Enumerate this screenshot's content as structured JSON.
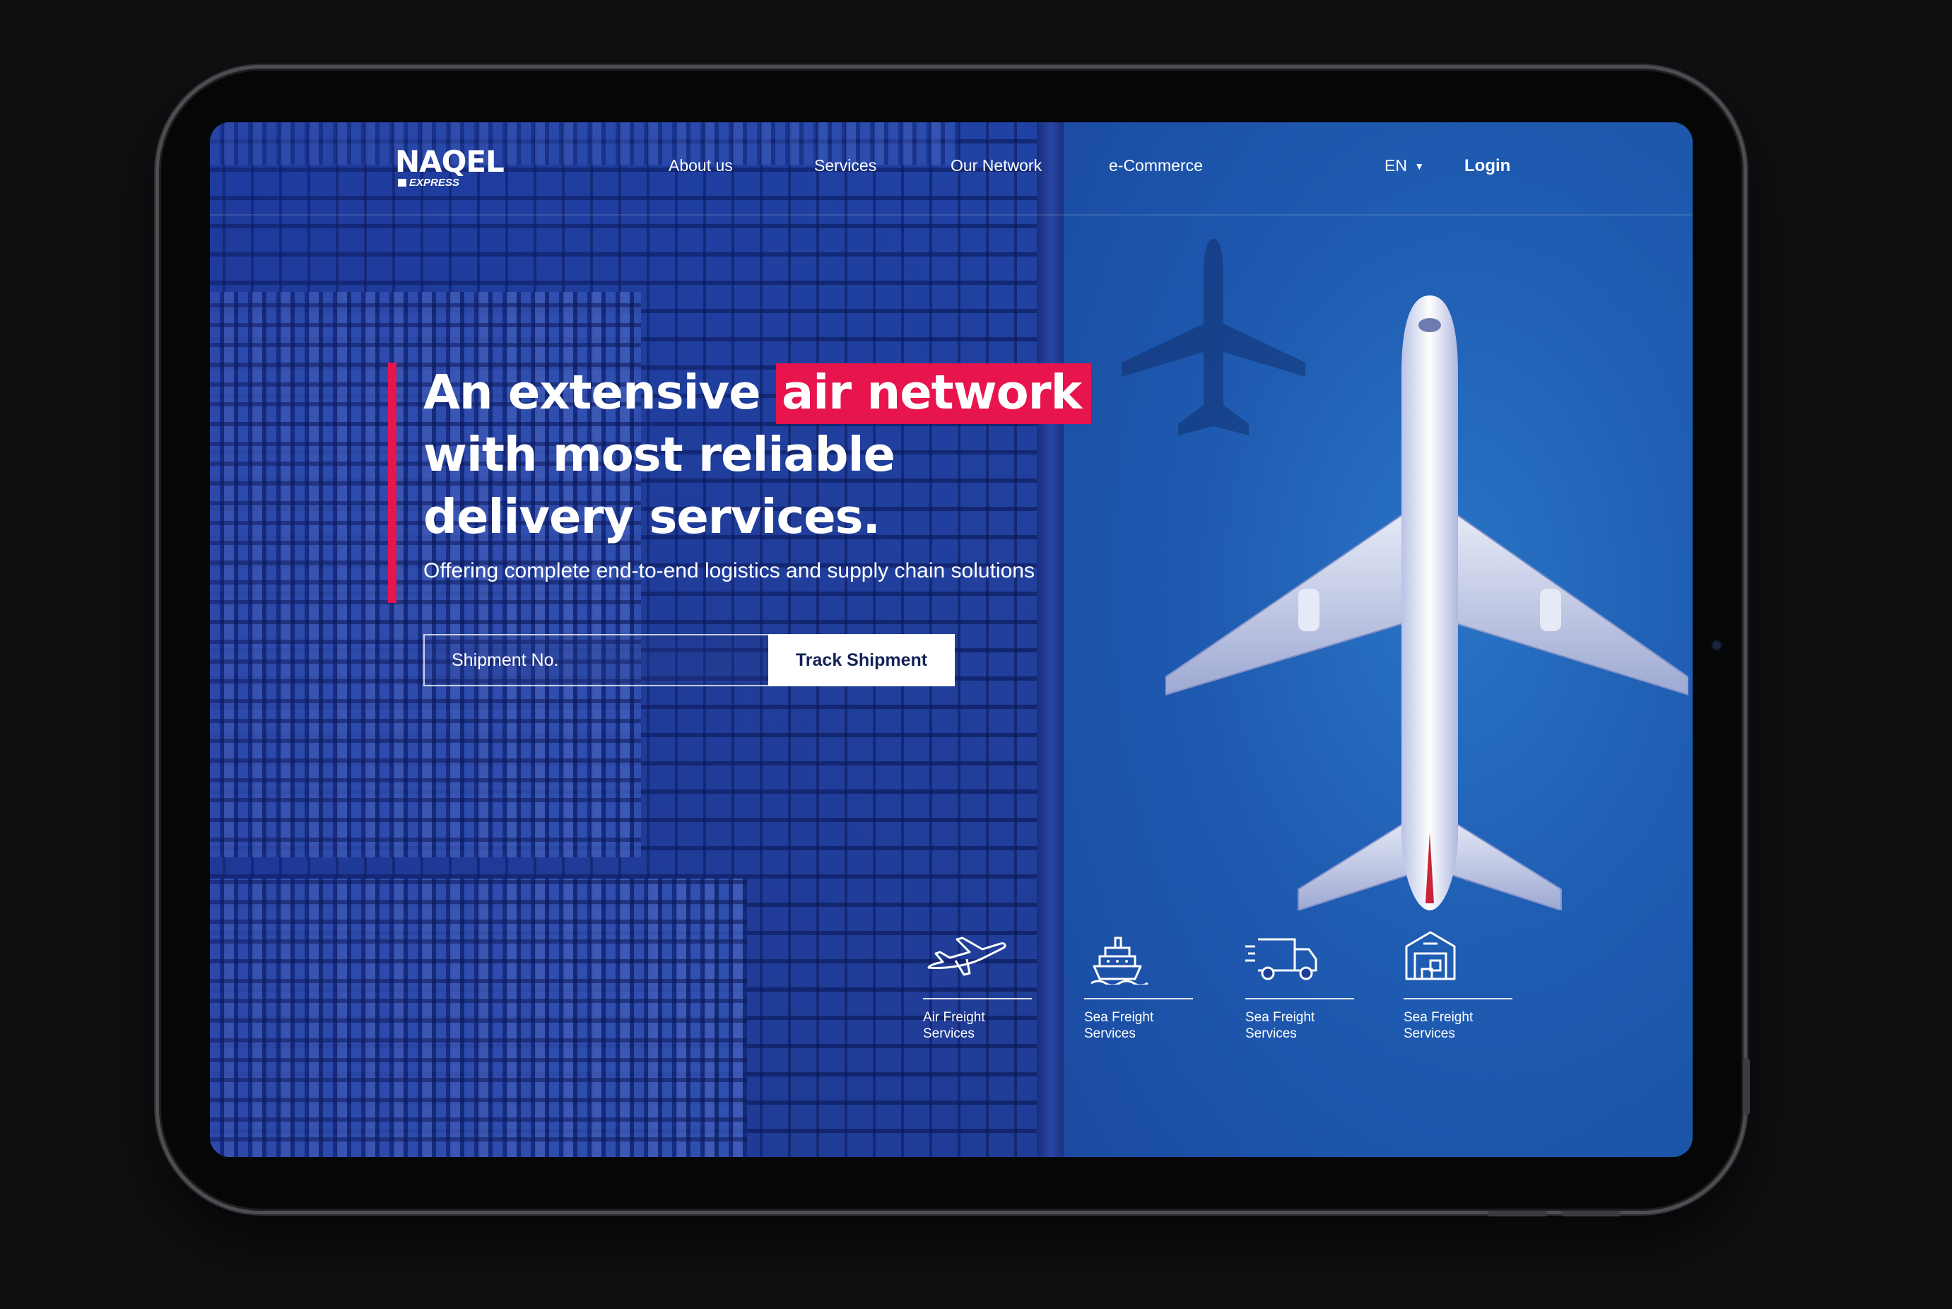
{
  "brand": {
    "logo_main": "NAQEL",
    "logo_sub": "EXPRESS"
  },
  "nav": {
    "items": [
      "About us",
      "Services",
      "Our Network",
      "e-Commerce"
    ],
    "language": "EN",
    "login": "Login"
  },
  "hero": {
    "title_part1": "An extensive",
    "title_highlight": "air network",
    "title_line2": "with most reliable",
    "title_line3": "delivery services.",
    "subtitle": "Offering complete end-to-end logistics and supply chain solutions"
  },
  "tracking": {
    "placeholder": "Shipment No.",
    "value": "",
    "button": "Track Shipment"
  },
  "services": [
    {
      "label": "Air Freight Services",
      "icon": "airplane-icon"
    },
    {
      "label": "Sea Freight Services",
      "icon": "ship-icon"
    },
    {
      "label": "Sea Freight Services",
      "icon": "truck-icon"
    },
    {
      "label": "Sea Freight Services",
      "icon": "warehouse-icon"
    }
  ],
  "colors": {
    "accent": "#e8144e",
    "primary_blue": "#1d3c96",
    "bg": "#0e1011"
  }
}
